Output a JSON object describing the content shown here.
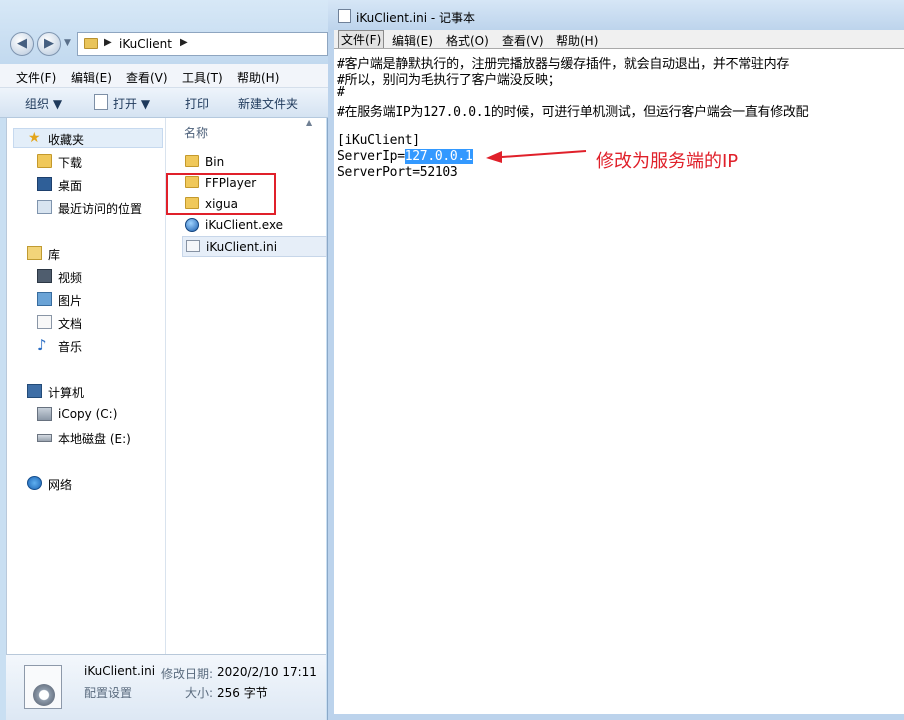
{
  "explorer": {
    "address": {
      "folder": "iKuClient"
    },
    "menu": [
      "文件(F)",
      "编辑(E)",
      "查看(V)",
      "工具(T)",
      "帮助(H)"
    ],
    "toolbar": {
      "organize": "组织",
      "open": "打开",
      "print": "打印",
      "new_folder": "新建文件夹"
    },
    "nav": {
      "favorites": "收藏夹",
      "downloads": "下载",
      "desktop": "桌面",
      "recent": "最近访问的位置",
      "libraries": "库",
      "videos": "视频",
      "pictures": "图片",
      "documents": "文档",
      "music": "音乐",
      "computer": "计算机",
      "drive_c": "iCopy (C:)",
      "drive_e": "本地磁盘 (E:)",
      "network": "网络"
    },
    "column_header": "名称",
    "files": [
      "Bin",
      "FFPlayer",
      "xigua",
      "iKuClient.exe",
      "iKuClient.ini"
    ],
    "details": {
      "filename": "iKuClient.ini",
      "modified_label": "修改日期:",
      "modified_value": "2020/2/10 17:11",
      "type": "配置设置",
      "size_label": "大小:",
      "size_value": "256 字节"
    }
  },
  "notepad": {
    "title": "iKuClient.ini - 记事本",
    "menu": [
      "文件(F)",
      "编辑(E)",
      "格式(O)",
      "查看(V)",
      "帮助(H)"
    ],
    "lines": [
      "#客户端是静默执行的，注册完播放器与缓存插件，就会自动退出，并不常驻内存",
      "#所以，别问为毛执行了客户端没反映；",
      "#",
      "#在服务端IP为127.0.0.1的时候，可进行单机测试，但运行客户端会一直有修改配",
      "",
      "[iKuClient]",
      "ServerIp=",
      "ServerPort=52103"
    ],
    "selected_value": "127.0.0.1"
  },
  "annotation": {
    "text": "修改为服务端的IP",
    "color": "#e0202a"
  }
}
